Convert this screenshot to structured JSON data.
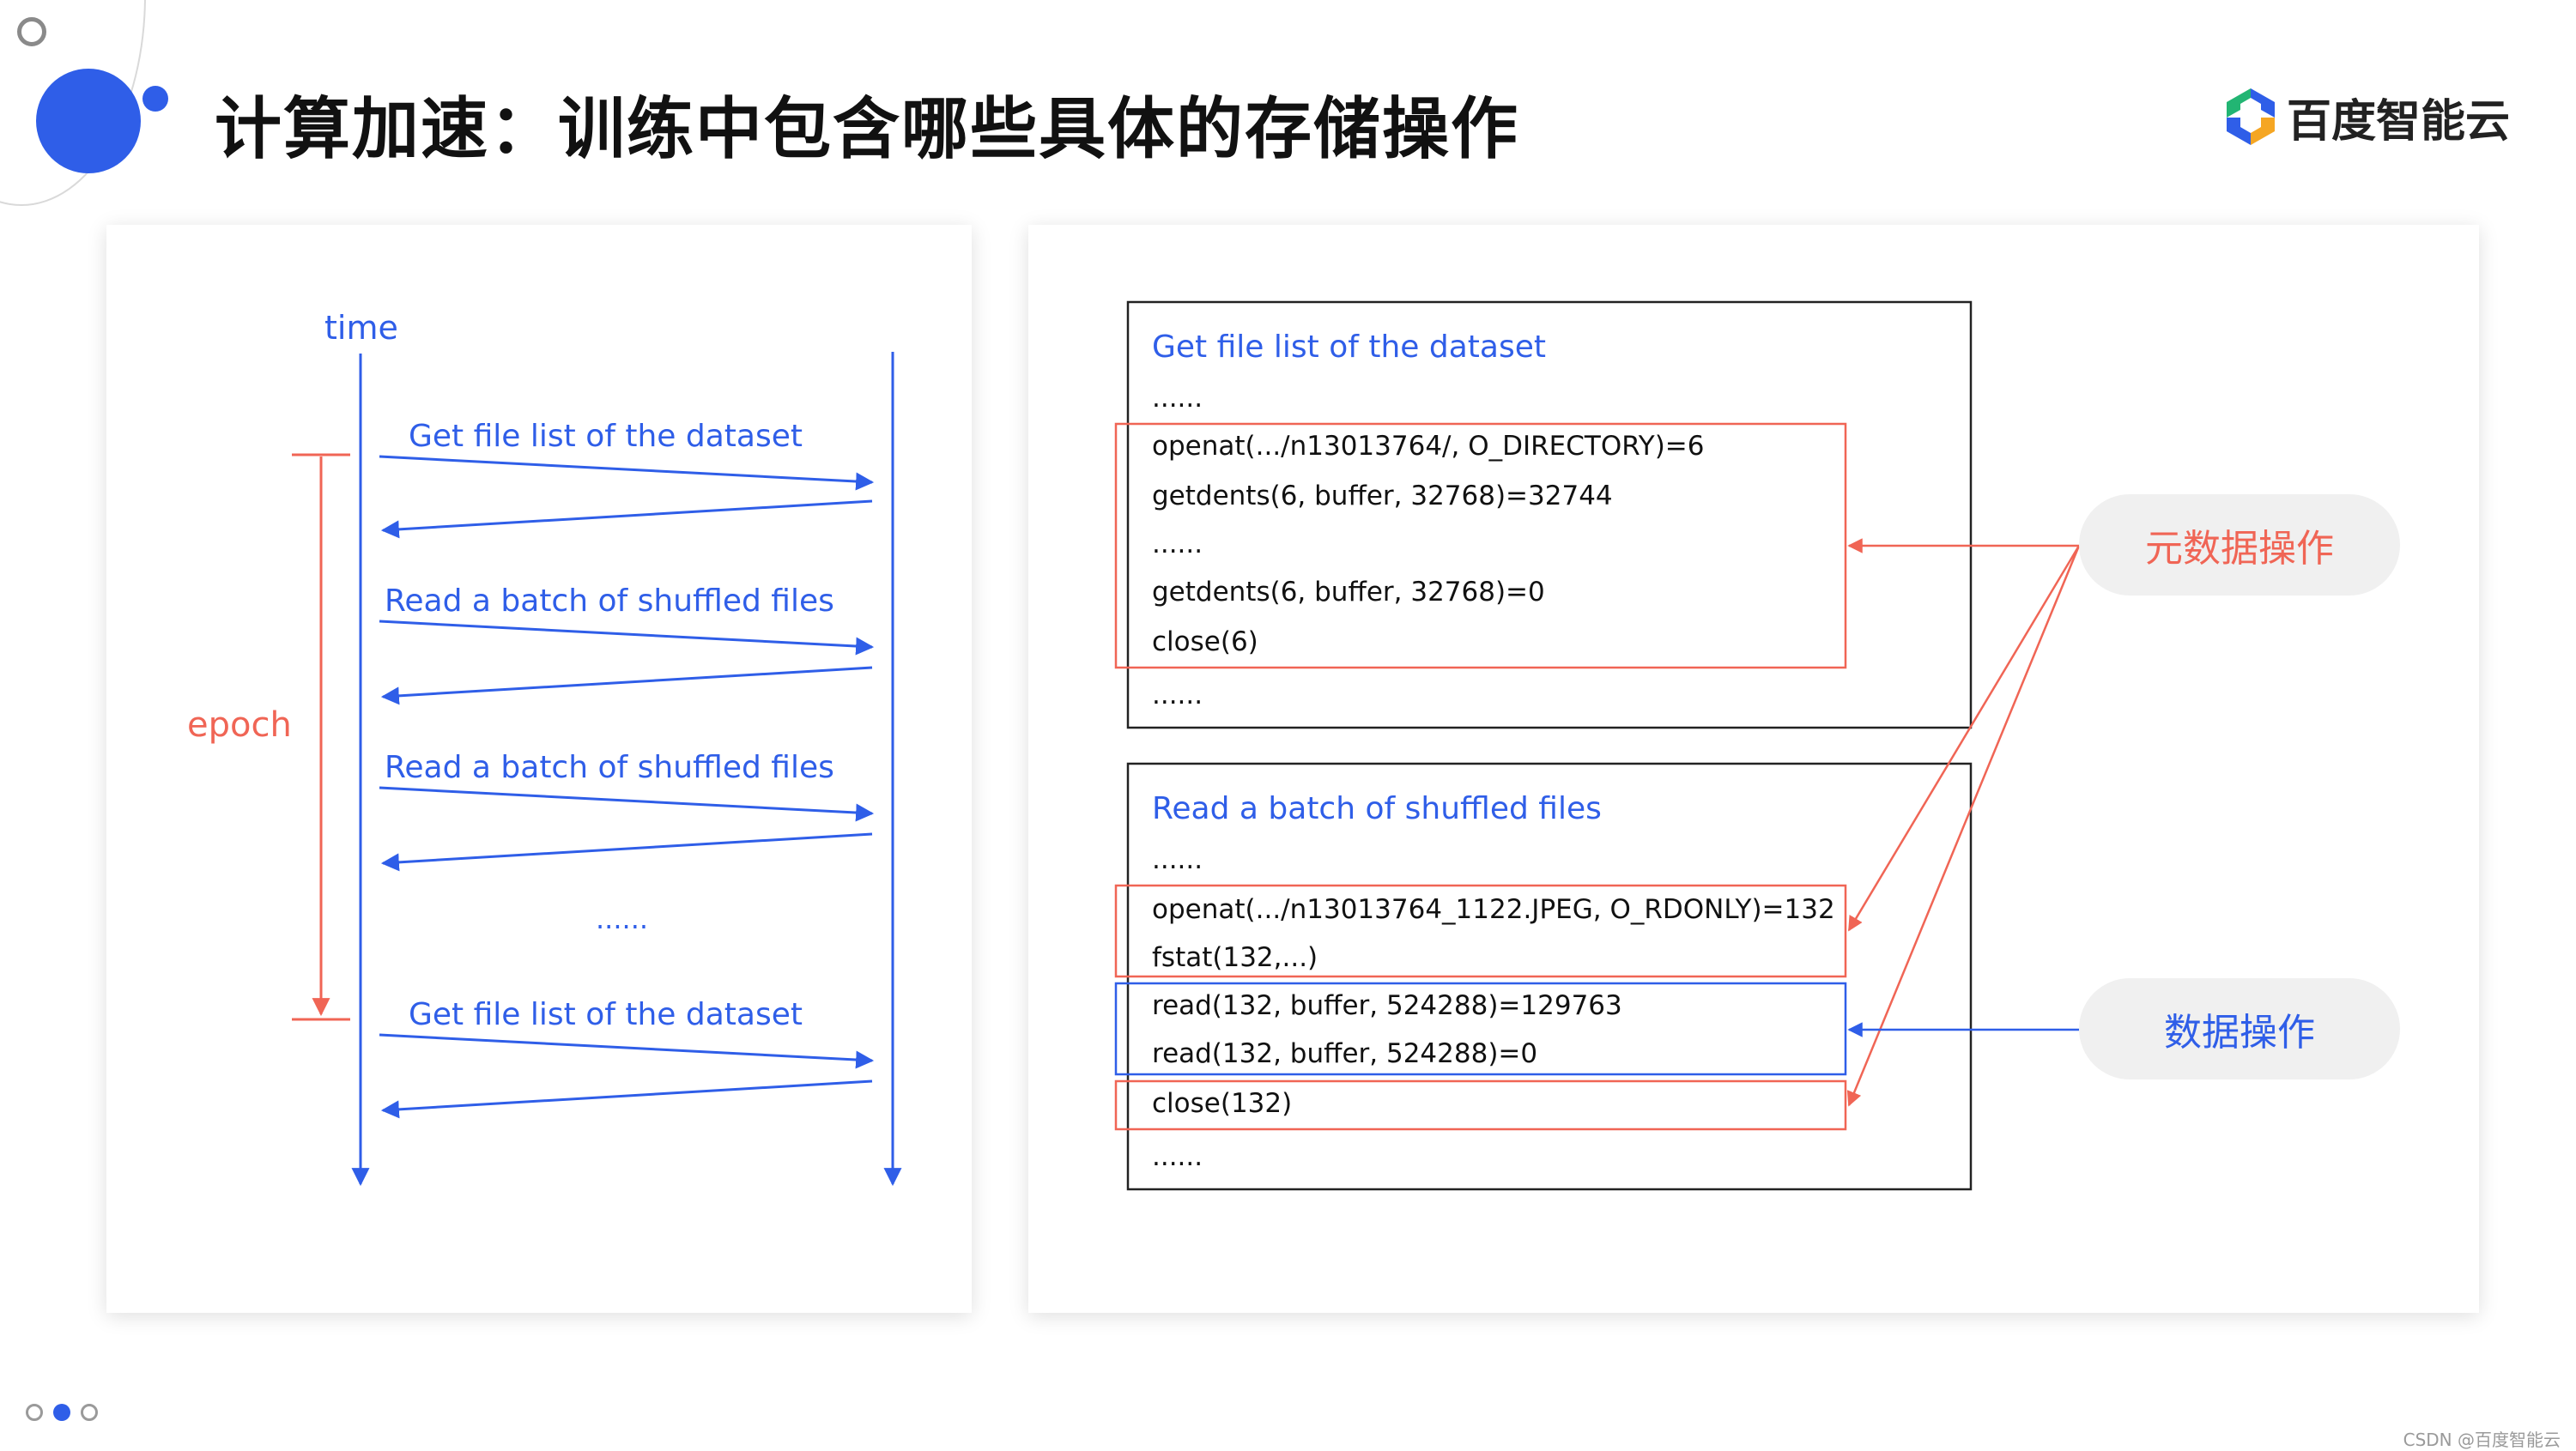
{
  "slide": {
    "title": "计算加速：训练中包含哪些具体的存储操作",
    "logo_text": "百度智能云",
    "watermark": "CSDN @百度智能云",
    "pager": {
      "count": 3,
      "active": 1
    }
  },
  "colors": {
    "blue": "#2f5ee8",
    "red": "#f06555",
    "box_border": "#222222",
    "text": "#111111"
  },
  "timeline": {
    "axis_label": "time",
    "epoch_label": "epoch",
    "ellipsis": "......",
    "steps": [
      {
        "label": "Get file list of the dataset"
      },
      {
        "label": "Read a batch of shuffled files"
      },
      {
        "label": "Read a batch of shuffled files"
      },
      {
        "label": "......"
      },
      {
        "label": "Get file list of the dataset"
      }
    ]
  },
  "traces": [
    {
      "title": "Get file list of the dataset",
      "lines": [
        "......",
        "openat(.../n13013764/, O_DIRECTORY)=6",
        "getdents(6, buffer, 32768)=32744",
        "......",
        "getdents(6, buffer, 32768)=0",
        "close(6)",
        "......"
      ]
    },
    {
      "title": "Read a batch of shuffled files",
      "lines": [
        "......",
        "openat(.../n13013764_1122.JPEG, O_RDONLY)=132",
        "fstat(132,...)",
        "read(132, buffer, 524288)=129763",
        "read(132, buffer, 524288)=0",
        "close(132)",
        "......"
      ]
    }
  ],
  "categories": {
    "metadata": "元数据操作",
    "data": "数据操作"
  }
}
